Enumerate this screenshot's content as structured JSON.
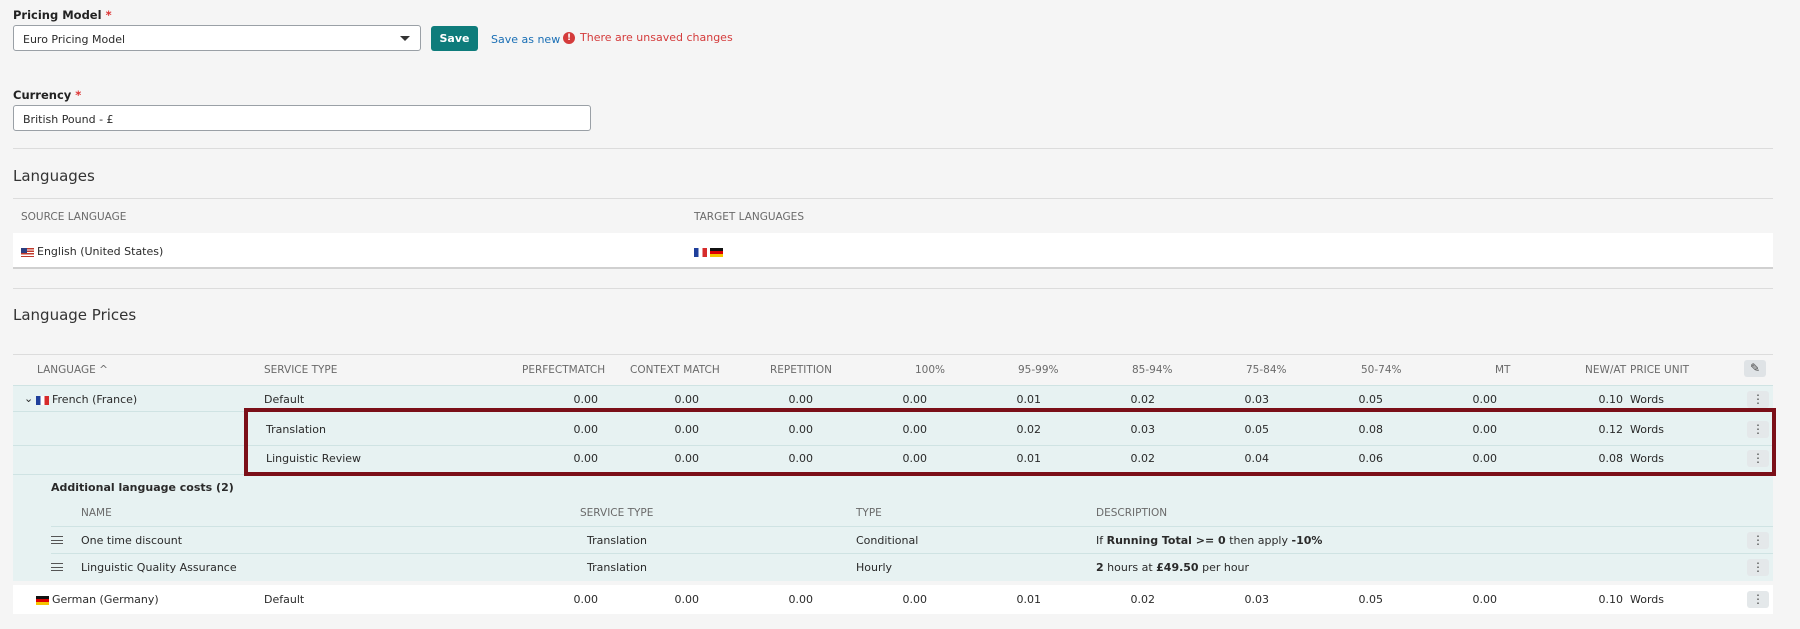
{
  "pricing_model": {
    "label": "Pricing Model",
    "required": "*",
    "value": "Euro Pricing Model",
    "save_label": "Save",
    "save_as_new_label": "Save as new",
    "unsaved_warning": "There are unsaved changes"
  },
  "currency": {
    "label": "Currency",
    "required": "*",
    "value": "British Pound - £"
  },
  "languages": {
    "title": "Languages",
    "col_source": "SOURCE LANGUAGE",
    "col_target": "TARGET LANGUAGES",
    "source": "English (United States)",
    "target_flags": [
      "flag-fr",
      "flag-de"
    ]
  },
  "language_prices": {
    "title": "Language Prices",
    "columns": {
      "language": "LANGUAGE",
      "service_type": "SERVICE TYPE",
      "perfectmatch": "PERFECTMATCH",
      "context_match": "CONTEXT MATCH",
      "repetition": "REPETITION",
      "p100": "100%",
      "p95": "95-99%",
      "p85": "85-94%",
      "p75": "75-84%",
      "p50": "50-74%",
      "mt": "MT",
      "new": "NEW/AT",
      "price_unit": "PRICE UNIT"
    },
    "rows": [
      {
        "language": "French (France)",
        "service": "Default",
        "values": [
          "0.00",
          "0.00",
          "0.00",
          "0.00",
          "0.01",
          "0.02",
          "0.03",
          "0.05",
          "0.00",
          "0.10"
        ],
        "unit": "Words"
      },
      {
        "language": "",
        "service": "Translation",
        "values": [
          "0.00",
          "0.00",
          "0.00",
          "0.00",
          "0.02",
          "0.03",
          "0.05",
          "0.08",
          "0.00",
          "0.12"
        ],
        "unit": "Words"
      },
      {
        "language": "",
        "service": "Linguistic Review",
        "values": [
          "0.00",
          "0.00",
          "0.00",
          "0.00",
          "0.01",
          "0.02",
          "0.04",
          "0.06",
          "0.00",
          "0.08"
        ],
        "unit": "Words"
      },
      {
        "language": "German (Germany)",
        "service": "Default",
        "values": [
          "0.00",
          "0.00",
          "0.00",
          "0.00",
          "0.01",
          "0.02",
          "0.03",
          "0.05",
          "0.00",
          "0.10"
        ],
        "unit": "Words"
      }
    ],
    "additional": {
      "title": "Additional language costs (2)",
      "col_name": "NAME",
      "col_service": "SERVICE TYPE",
      "col_type": "TYPE",
      "col_desc": "DESCRIPTION",
      "items": [
        {
          "name": "One time discount",
          "service": "Translation",
          "type": "Conditional",
          "desc_pre": "If ",
          "desc_b1": "Running Total >= 0",
          "desc_mid": " then apply ",
          "desc_b2": "-10%"
        },
        {
          "name": "Linguistic Quality Assurance",
          "service": "Translation",
          "type": "Hourly",
          "desc_pre": "",
          "desc_b1": "2",
          "desc_mid": " hours at ",
          "desc_b2": "£49.50",
          "desc_post": " per hour"
        }
      ]
    }
  },
  "colors": {
    "accent": "#0e7c7b",
    "warning": "#d43b3b",
    "highlight": "#7b0f18",
    "row_tint": "#e7f2f2"
  }
}
